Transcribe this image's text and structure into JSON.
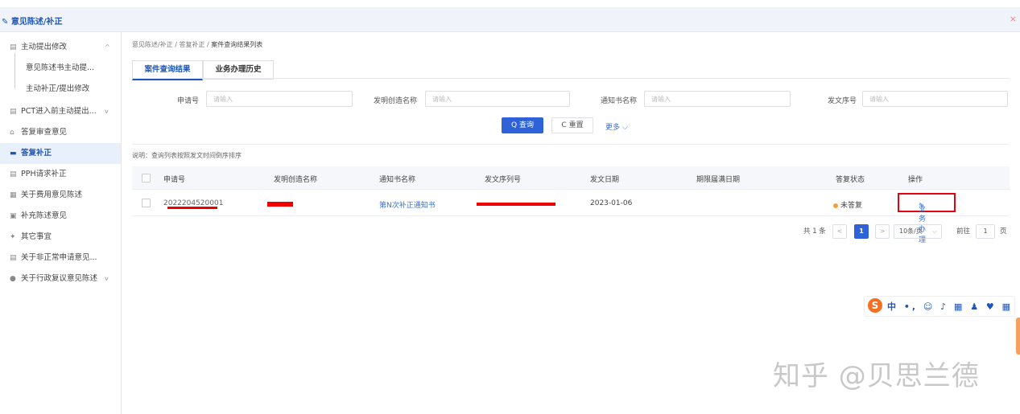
{
  "window": {
    "title": "意见陈述/补正",
    "close_glyph": "×"
  },
  "sidebar": {
    "items": [
      {
        "icon": "document-icon",
        "glyph": "▤",
        "label": "主动提出修改",
        "arrow": "^",
        "active": false,
        "sub": false
      },
      {
        "icon": "",
        "glyph": "",
        "label": "意见陈述书主动提...",
        "arrow": "",
        "active": false,
        "sub": true
      },
      {
        "icon": "",
        "glyph": "",
        "label": "主动补正/提出修改",
        "arrow": "",
        "active": false,
        "sub": true
      },
      {
        "icon": "file-icon",
        "glyph": "▤",
        "label": "PCT进入前主动提出...",
        "arrow": "v",
        "active": false,
        "sub": false
      },
      {
        "icon": "hat-icon",
        "glyph": "⌂",
        "label": "答复审查意见",
        "arrow": "",
        "active": false,
        "sub": false
      },
      {
        "icon": "card-icon",
        "glyph": "▬",
        "label": "答复补正",
        "arrow": "",
        "active": true,
        "sub": false
      },
      {
        "icon": "file-icon",
        "glyph": "▤",
        "label": "PPH请求补正",
        "arrow": "",
        "active": false,
        "sub": false
      },
      {
        "icon": "list-icon",
        "glyph": "▦",
        "label": "关于费用意见陈述",
        "arrow": "",
        "active": false,
        "sub": false
      },
      {
        "icon": "image-icon",
        "glyph": "▣",
        "label": "补充陈述意见",
        "arrow": "",
        "active": false,
        "sub": false
      },
      {
        "icon": "pin-icon",
        "glyph": "✦",
        "label": "其它事宜",
        "arrow": "",
        "active": false,
        "sub": false
      },
      {
        "icon": "doc-icon",
        "glyph": "▤",
        "label": "关于非正常申请意见...",
        "arrow": "",
        "active": false,
        "sub": false
      },
      {
        "icon": "info-icon",
        "glyph": "●",
        "label": "关于行政复议意见陈述",
        "arrow": "v",
        "active": false,
        "sub": false
      }
    ]
  },
  "breadcrumb": {
    "items": [
      "意见陈述/补正",
      "答复补正",
      "案件查询结果列表"
    ],
    "sep": " / "
  },
  "tabs": [
    {
      "label": "案件查询结果",
      "active": true
    },
    {
      "label": "业务办理历史",
      "active": false
    }
  ],
  "filters": [
    {
      "label": "申请号",
      "placeholder": "请输入"
    },
    {
      "label": "发明创造名称",
      "placeholder": "请输入"
    },
    {
      "label": "通知书名称",
      "placeholder": "请输入"
    },
    {
      "label": "发文序号",
      "placeholder": "请输入"
    }
  ],
  "buttons": {
    "query": "Q 查询",
    "reset": "C 重置",
    "more": "更多 ⌵"
  },
  "note": "说明：查询列表按照发文时间倒序排序",
  "table": {
    "headers": [
      "申请号",
      "发明创造名称",
      "通知书名称",
      "发文序列号",
      "发文日期",
      "期限届满日期",
      "答复状态",
      "操作"
    ],
    "rows": [
      {
        "app_no": "2022204520001",
        "invention": "",
        "notice": "第N次补正通知书",
        "serial": "",
        "date": "2023-01-06",
        "deadline": "",
        "status": "未答复",
        "action": "业务办理"
      }
    ]
  },
  "pagination": {
    "total": "共 1 条",
    "prev": "<",
    "current": "1",
    "next": ">",
    "size": "10条/页",
    "goto_label": "前往",
    "goto_value": "1",
    "page_suffix": "页"
  },
  "ime": {
    "logo": "S",
    "items": "中 •, ☺ ♪ ▦ ♟ ♥ ▦"
  },
  "watermark": "知乎 @贝思兰德",
  "colors": {
    "accent": "#2e62d8",
    "title": "#1d56b8",
    "highlight": "#e60012",
    "status_dot": "#f0a040"
  }
}
